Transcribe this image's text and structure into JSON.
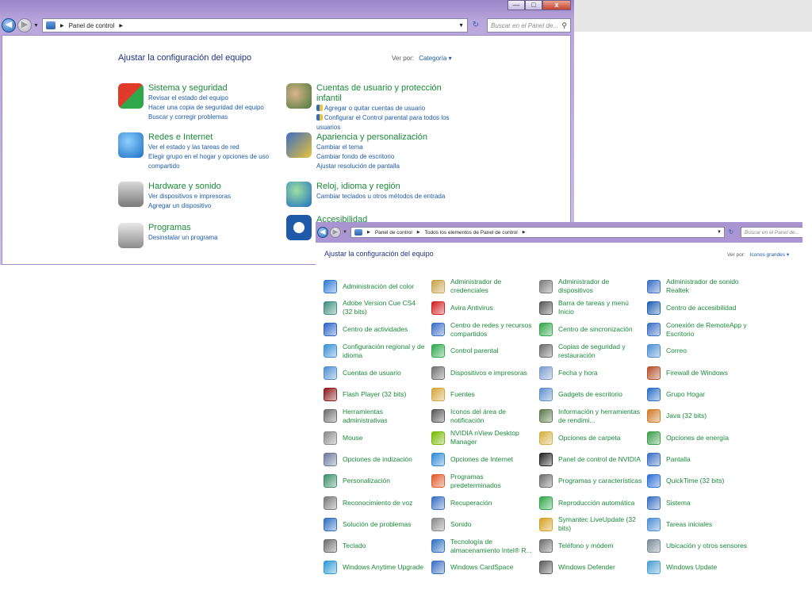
{
  "window1": {
    "window_controls": [
      "—",
      "□",
      "x"
    ],
    "breadcrumb": [
      "Panel de control"
    ],
    "search_placeholder": "Buscar en el Panel de...",
    "heading": "Ajustar la configuración del equipo",
    "view_by_label": "Ver por:",
    "view_by_value": "Categoría",
    "categories": [
      {
        "title": "Sistema y seguridad",
        "icon": "shield-icon",
        "links": [
          "Revisar el estado del equipo",
          "Hacer una copia de seguridad del equipo",
          "Buscar y corregir problemas"
        ],
        "shield_links": [
          false,
          false,
          false
        ]
      },
      {
        "title": "Redes e Internet",
        "icon": "globe-network-icon",
        "links": [
          "Ver el estado y las tareas de red",
          "Elegir grupo en el hogar y opciones de uso compartido"
        ],
        "shield_links": [
          false,
          false
        ]
      },
      {
        "title": "Hardware y sonido",
        "icon": "printer-icon",
        "links": [
          "Ver dispositivos e impresoras",
          "Agregar un dispositivo"
        ],
        "shield_links": [
          false,
          false
        ]
      },
      {
        "title": "Programas",
        "icon": "programs-icon",
        "links": [
          "Desinstalar un programa"
        ],
        "shield_links": [
          false
        ]
      },
      {
        "title": "Cuentas de usuario y protección infantil",
        "icon": "users-icon",
        "links": [
          "Agregar o quitar cuentas de usuario",
          "Configurar el Control parental para todos los usuarios"
        ],
        "shield_links": [
          true,
          true
        ]
      },
      {
        "title": "Apariencia y personalización",
        "icon": "appearance-icon",
        "links": [
          "Cambiar el tema",
          "Cambiar fondo de escritorio",
          "Ajustar resolución de pantalla"
        ],
        "shield_links": [
          false,
          false,
          false
        ]
      },
      {
        "title": "Reloj, idioma y región",
        "icon": "clock-globe-icon",
        "links": [
          "Cambiar teclados u otros métodos de entrada"
        ],
        "shield_links": [
          false
        ]
      },
      {
        "title": "Accesibilidad",
        "icon": "accessibility-icon",
        "links": [],
        "shield_links": []
      }
    ]
  },
  "window2": {
    "breadcrumb": [
      "Panel de control",
      "Todos los elementos de Panel de control"
    ],
    "search_placeholder": "Buscar en el Panel de...",
    "heading": "Ajustar la configuración del equipo",
    "view_by_label": "Ver por:",
    "view_by_value": "Iconos grandes",
    "items": [
      [
        "Administración del color",
        "Administrador de credenciales",
        "Administrador de dispositivos",
        "Administrador de sonido Realtek"
      ],
      [
        "Adobe Version Cue CS4 (32 bits)",
        "Avira Antivirus",
        "Barra de tareas y menú Inicio",
        "Centro de accesibilidad"
      ],
      [
        "Centro de actividades",
        "Centro de redes y recursos compartidos",
        "Centro de sincronización",
        "Conexión de RemoteApp y Escritorio"
      ],
      [
        "Configuración regional y de idioma",
        "Control parental",
        "Copias de seguridad y restauración",
        "Correo"
      ],
      [
        "Cuentas de usuario",
        "Dispositivos e impresoras",
        "Fecha y hora",
        "Firewall de Windows"
      ],
      [
        "Flash Player (32 bits)",
        "Fuentes",
        "Gadgets de escritorio",
        "Grupo Hogar"
      ],
      [
        "Herramientas administrativas",
        "Iconos del área de notificación",
        "Información y herramientas de rendimi...",
        "Java (32 bits)"
      ],
      [
        "Mouse",
        "NVIDIA nView Desktop Manager",
        "Opciones de carpeta",
        "Opciones de energía"
      ],
      [
        "Opciones de indización",
        "Opciones de Internet",
        "Panel de control de NVIDIA",
        "Pantalla"
      ],
      [
        "Personalización",
        "Programas predeterminados",
        "Programas y características",
        "QuickTime (32 bits)"
      ],
      [
        "Reconocimiento de voz",
        "Recuperación",
        "Reproducción automática",
        "Sistema"
      ],
      [
        "Solución de problemas",
        "Sonido",
        "Symantec LiveUpdate (32 bits)",
        "Tareas iniciales"
      ],
      [
        "Teclado",
        "Tecnología de almacenamiento Intel® R...",
        "Teléfono y módem",
        "Ubicación y otros sensores"
      ],
      [
        "Windows Anytime Upgrade",
        "Windows CardSpace",
        "Windows Defender",
        "Windows Update"
      ]
    ],
    "icon_colors": [
      [
        "#2f7bd6",
        "#c9a24a",
        "#7a7a7a",
        "#3a6fc4"
      ],
      [
        "#3f8f7a",
        "#d32020",
        "#555555",
        "#1f5fb3"
      ],
      [
        "#2c64c6",
        "#3a6fc4",
        "#2fa84a",
        "#3a6fc4"
      ],
      [
        "#3a8fd6",
        "#2fa84a",
        "#6b6b6b",
        "#4a8fd4"
      ],
      [
        "#4e8fd0",
        "#707070",
        "#7a9ccf",
        "#b4502a"
      ],
      [
        "#8b1a1a",
        "#d4a53a",
        "#5f8fd0",
        "#2a6fc8"
      ],
      [
        "#6d6d6d",
        "#555555",
        "#5a7a4a",
        "#d07a28"
      ],
      [
        "#8a8a8a",
        "#76b900",
        "#d4b040",
        "#3a9f4a"
      ],
      [
        "#6b7a9a",
        "#2f8ad6",
        "#222222",
        "#3a6fc4"
      ],
      [
        "#3a8f6a",
        "#e25a2a",
        "#6d6d6d",
        "#2d6ed6"
      ],
      [
        "#7a7a7a",
        "#3a6fc4",
        "#2fa84a",
        "#3a6fc4"
      ],
      [
        "#2f6fc1",
        "#8a8a8a",
        "#d4a020",
        "#4a8fd4"
      ],
      [
        "#6e6e6e",
        "#2f6fc1",
        "#6e6e6e",
        "#7a8a9a"
      ],
      [
        "#2f9ad6",
        "#3a6fc4",
        "#5a5a5a",
        "#4a9fd4"
      ]
    ]
  }
}
